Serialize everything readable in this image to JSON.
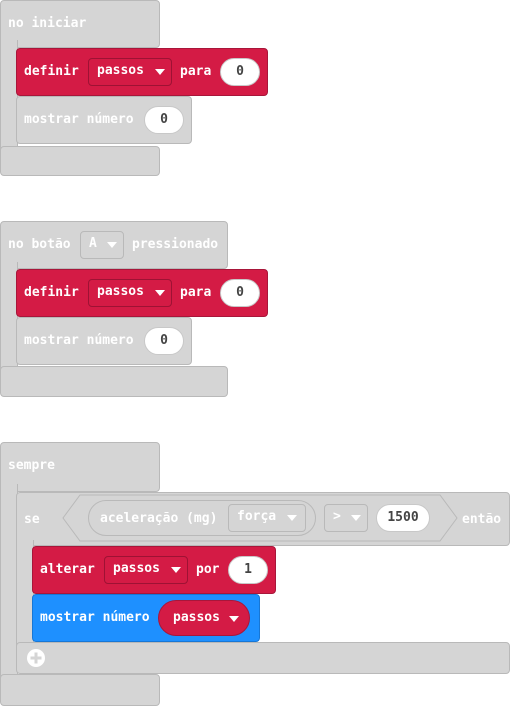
{
  "on_start": {
    "hat_label": "no iniciar",
    "set_label": "definir",
    "set_var": "passos",
    "to_label": "para",
    "set_value": "0",
    "show_label": "mostrar número",
    "show_value": "0"
  },
  "on_button": {
    "hat_prefix": "no botão",
    "button": "A",
    "hat_suffix": "pressionado",
    "set_label": "definir",
    "set_var": "passos",
    "to_label": "para",
    "set_value": "0",
    "show_label": "mostrar número",
    "show_value": "0"
  },
  "forever": {
    "hat_label": "sempre",
    "if_label": "se",
    "accel_label": "aceleração (mg)",
    "accel_dim": "força",
    "compare_op": ">",
    "compare_value": "1500",
    "then_label": "então",
    "change_label": "alterar",
    "change_var": "passos",
    "by_label": "por",
    "change_value": "1",
    "show_label": "mostrar número",
    "show_var": "passos"
  },
  "colors": {
    "variables_red": "#d41b45",
    "basic_blue": "#1e90ff",
    "disabled_gray": "#d5d5d5"
  },
  "icons": {
    "add_else": "plus-circle-icon"
  }
}
